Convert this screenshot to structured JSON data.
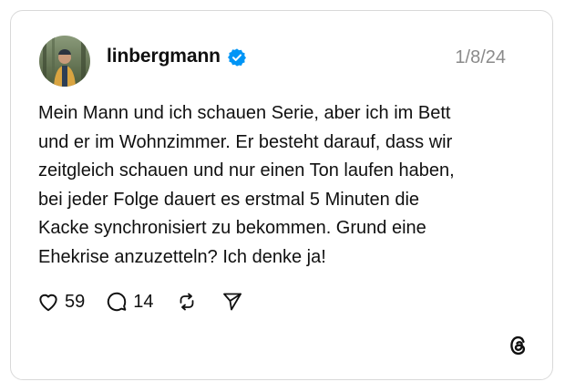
{
  "post": {
    "username": "linbergmann",
    "date": "1/8/24",
    "text": "Mein Mann und ich schauen Serie, aber ich im Bett\nund er im Wohnzimmer. Er besteht darauf, dass wir\nzeitgleich schauen und nur einen Ton laufen haben,\nbei jeder Folge dauert es erstmal 5 Minuten die\nKacke synchronisiert zu bekommen. Grund eine\nEhekrise anzuzetteln? Ich denke ja!",
    "likes": "59",
    "replies": "14"
  },
  "icons": {
    "verified": "verified-badge-icon",
    "like": "heart-icon",
    "reply": "comment-icon",
    "repost": "repost-icon",
    "share": "send-icon",
    "brand": "threads-logo-icon"
  },
  "colors": {
    "verified": "#0095f6",
    "date": "#8a8a8a",
    "text": "#101010",
    "border": "#d9d9d9"
  }
}
